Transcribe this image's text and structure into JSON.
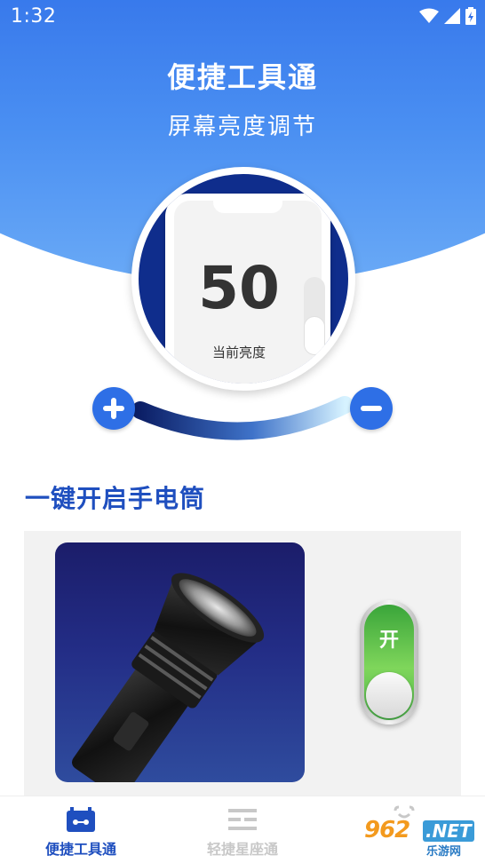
{
  "status_bar": {
    "time": "1:32"
  },
  "header": {
    "title": "便捷工具通",
    "subtitle": "屏幕亮度调节"
  },
  "brightness": {
    "value": "50",
    "label": "当前亮度",
    "level_fraction": 0.5
  },
  "controls": {
    "increase_icon": "plus-icon",
    "decrease_icon": "minus-icon"
  },
  "flashlight": {
    "section_title": "一键开启手电筒",
    "switch_label": "开",
    "switch_state": "on"
  },
  "tabbar": {
    "tabs": [
      {
        "label": "便捷工具通",
        "icon": "toolbox-icon",
        "active": true
      },
      {
        "label": "轻捷星座通",
        "icon": "list-icon",
        "active": false
      },
      {
        "label": "",
        "icon": "face-icon",
        "active": false
      }
    ]
  },
  "watermark": {
    "main": "962",
    "suffix": ".NET",
    "sub": "乐游网"
  },
  "colors": {
    "primary": "#2e6fe6",
    "title_blue": "#1f4fbf",
    "switch_green": "#5cc04a",
    "inactive_tab": "#c8c8c8"
  }
}
